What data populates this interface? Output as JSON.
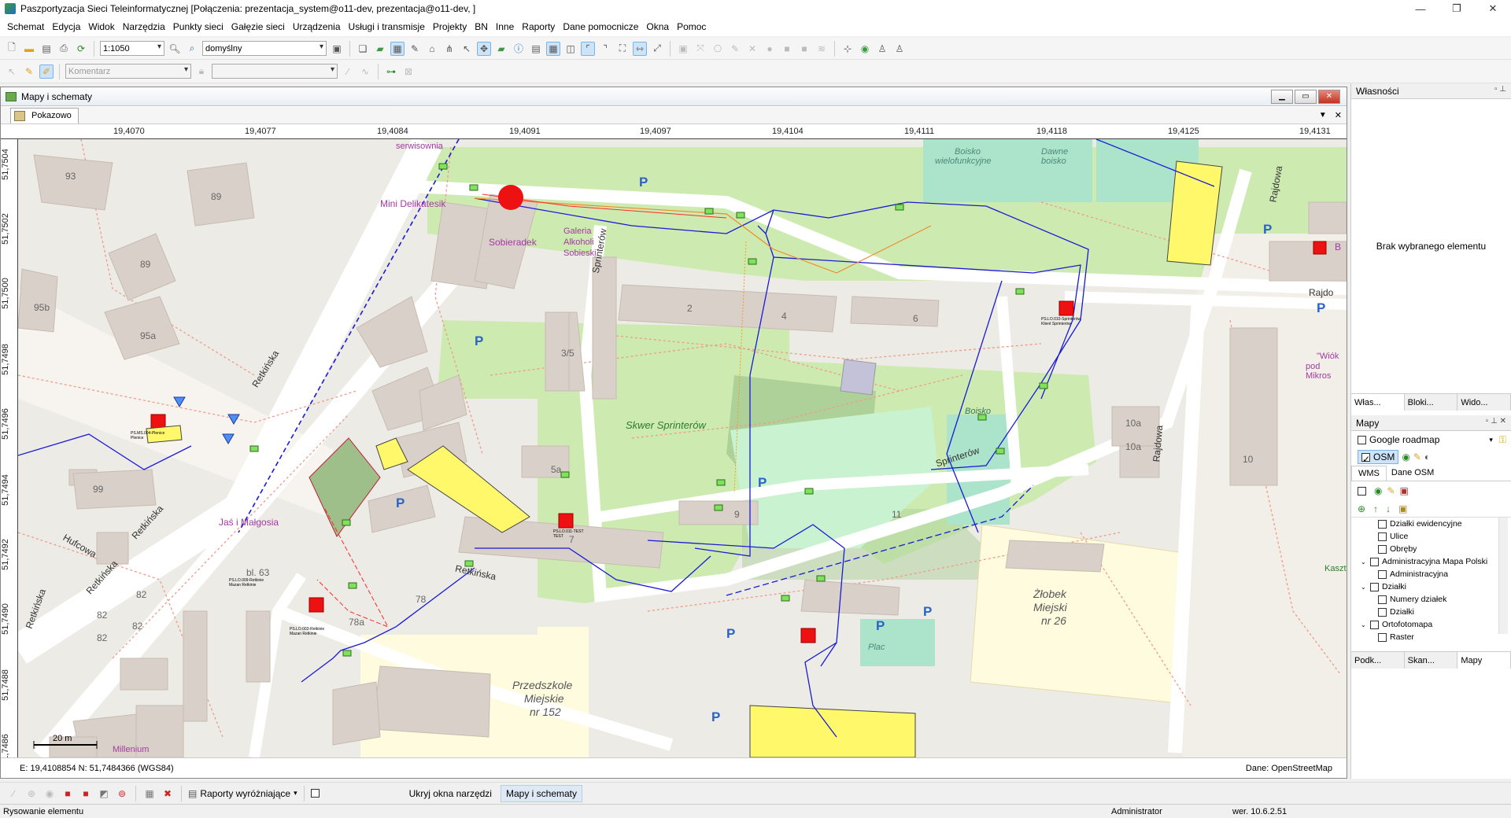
{
  "window": {
    "title": "Paszportyzacja Sieci Teleinformatycznej [Połączenia: prezentacja_system@o11-dev, prezentacja@o11-dev, ]"
  },
  "menu": [
    "Schemat",
    "Edycja",
    "Widok",
    "Narzędzia",
    "Punkty sieci",
    "Gałęzie sieci",
    "Urządzenia",
    "Usługi i transmisje",
    "Projekty",
    "BN",
    "Inne",
    "Raporty",
    "Dane pomocnicze",
    "Okna",
    "Pomoc"
  ],
  "toolbar1": {
    "scale": "1:1050",
    "view": "domyślny"
  },
  "toolbar2": {
    "comment_placeholder": "Komentarz"
  },
  "mdi": {
    "title": "Mapy i schematy",
    "tab": "Pokazowo"
  },
  "ruler": {
    "x_ticks": [
      "19,4070",
      "19,4077",
      "19,4084",
      "19,4091",
      "19,4097",
      "19,4104",
      "19,4111",
      "19,4118",
      "19,4125",
      "19,4131"
    ],
    "y_ticks": [
      "51,7504",
      "51,7502",
      "51,7500",
      "51,7498",
      "51,7496",
      "51,7494",
      "51,7492",
      "51,7490",
      "51,7488",
      "51,7486"
    ]
  },
  "map": {
    "labels": {
      "mini": "Mini Delikatesik",
      "sob": "Sobieradek",
      "gal1": "Galeria",
      "gal2": "Alkoholi",
      "gal3": "Sobieski",
      "retk1": "Retkińska",
      "retk2": "Retkińska",
      "retk3": "Retkińska",
      "retk4": "Retkińska",
      "retk5": "Retkińska",
      "hufc": "Hufcowa",
      "sprint1": "Sprinterów",
      "sprint2": "Sprinterów",
      "rajd1": "Rajdowa",
      "rajd2": "Rajdowa",
      "rajd3": "Rajdo",
      "skwer": "Skwer Sprinterów",
      "boisko": "Boisko",
      "boisko2": "Boisko",
      "boisko3": "wielofunkcyjne",
      "dawne1": "Dawne",
      "dawne2": "boisko",
      "zlob1": "Żłobek",
      "zlob2": "Miejski",
      "zlob3": "nr 26",
      "przed1": "Przedszkole",
      "przed2": "Miejskie",
      "przed3": "nr 152",
      "jas": "Jaś i Małgosia",
      "mil": "Millenium",
      "wiok1": "\"Wiók",
      "wiok2": "pod Mikros",
      "kasz": "Kaszt",
      "plac": "Plac",
      "b93": "93",
      "b89a": "89",
      "b89b": "89",
      "b95b": "95b",
      "b95a": "95a",
      "b35": "3/5",
      "b2": "2",
      "b4": "4",
      "b6": "6",
      "b5a": "5a",
      "b7": "7",
      "b9": "9",
      "b11": "11",
      "b10": "10",
      "b10a1": "10a",
      "b10a2": "10a",
      "b78": "78",
      "b78a": "78a",
      "b63": "bl. 63",
      "b99": "99",
      "b82a": "82",
      "b82b": "82",
      "b82c": "82",
      "b82d": "82",
      "serw": "serwisownia",
      "b5": "B",
      "pkt1": "PS.MS.004-Plenice Plenice",
      "pkt2": "PS.LO.011-TEST TEST",
      "pkt3": "PS.LO.009-Retkinie Mazan Retkinie",
      "pkt4": "PS.LO.010-Sprinterów Klient Sprinterów",
      "pkt5": "PS.LO.003-Retkinie Mazan Retkinie",
      "scale": "20 m"
    }
  },
  "status_map": {
    "coords": "E: 19,4108854  N: 51,7484366 (WGS84)",
    "source": "Dane: OpenStreetMap"
  },
  "right_panel": {
    "props_title": "Własności",
    "props_empty": "Brak wybranego elementu",
    "props_tabs": [
      "Włas...",
      "Bloki...",
      "Wido..."
    ],
    "maps_title": "Mapy",
    "google": "Google roadmap",
    "osm": "OSM",
    "wms_tabs": [
      "WMS",
      "Dane OSM"
    ],
    "tree": [
      "Działki ewidencyjne",
      "Ulice",
      "Obręby",
      "Administracyjna Mapa Polski",
      "Administracyjna",
      "Działki",
      "Numery działek",
      "Działki",
      "Ortofotomapa",
      "Raster"
    ],
    "bottom_tabs": [
      "Podk...",
      "Skan...",
      "Mapy"
    ]
  },
  "bottom": {
    "reports": "Raporty wyróżniające",
    "hide": "Ukryj okna narzędzi",
    "maps_btn": "Mapy i schematy"
  },
  "status": {
    "left": "Rysowanie elementu",
    "user": "Administrator",
    "version": "wer. 10.6.2.51"
  }
}
